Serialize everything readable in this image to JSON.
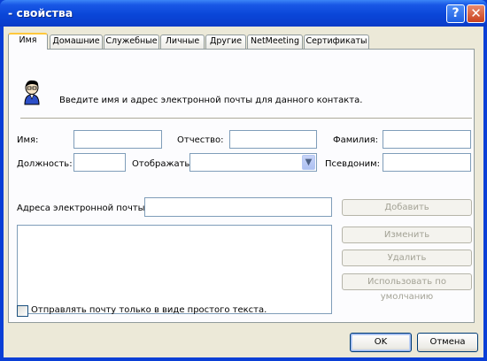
{
  "window": {
    "title": "- свойства",
    "help_icon": "help-icon",
    "close_icon": "close-icon"
  },
  "tabs": [
    {
      "label": "Имя",
      "active": true
    },
    {
      "label": "Домашние"
    },
    {
      "label": "Служебные"
    },
    {
      "label": "Личные"
    },
    {
      "label": "Другие"
    },
    {
      "label": "NetMeeting"
    },
    {
      "label": "Сертификаты"
    }
  ],
  "header": {
    "icon": "contact-person-icon",
    "text": "Введите имя и адрес электронной почты для данного контакта."
  },
  "fields": {
    "first_name": {
      "label": "Имя:",
      "value": ""
    },
    "middle_name": {
      "label": "Отчество:",
      "value": ""
    },
    "last_name": {
      "label": "Фамилия:",
      "value": ""
    },
    "title": {
      "label": "Должность:",
      "value": ""
    },
    "display": {
      "label": "Отображать:",
      "value": ""
    },
    "nickname": {
      "label": "Псевдоним:",
      "value": ""
    },
    "email": {
      "label": "Адреса электронной почты:",
      "value": ""
    }
  },
  "buttons": {
    "add": "Добавить",
    "edit": "Изменить",
    "remove": "Удалить",
    "set_default": "Использовать по умолчанию",
    "ok": "OK",
    "cancel": "Отмена"
  },
  "plain_text_checkbox": {
    "label": "Отправлять почту только в виде простого текста.",
    "checked": false
  },
  "colors": {
    "titlebar": "#0a46d8",
    "dialog_bg": "#ece9d8",
    "active_tab_accent": "#ffc83c"
  }
}
